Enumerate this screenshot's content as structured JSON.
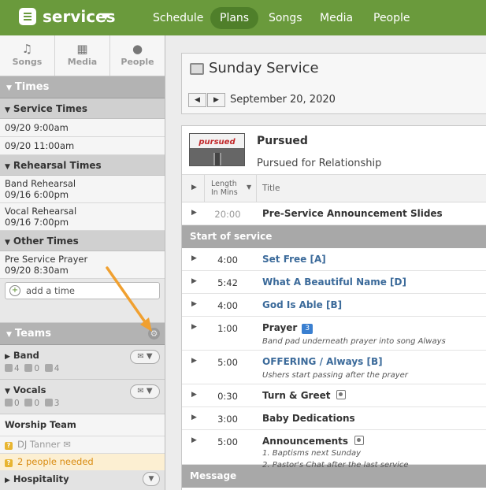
{
  "app": {
    "name": "services"
  },
  "nav": {
    "items": [
      "Schedule",
      "Plans",
      "Songs",
      "Media",
      "People"
    ],
    "active": "Plans"
  },
  "sidebar": {
    "tabs": [
      {
        "label": "Songs",
        "icon": "music-note-icon"
      },
      {
        "label": "Media",
        "icon": "film-icon"
      },
      {
        "label": "People",
        "icon": "person-icon"
      }
    ],
    "times_header": "Times",
    "service_times_header": "Service Times",
    "service_times": [
      "09/20 9:00am",
      "09/20 11:00am"
    ],
    "rehearsal_times_header": "Rehearsal Times",
    "rehearsal_times": [
      {
        "name": "Band Rehearsal",
        "time": "09/16 6:00pm"
      },
      {
        "name": "Vocal Rehearsal",
        "time": "09/16 7:00pm"
      }
    ],
    "other_times_header": "Other Times",
    "other_times": [
      {
        "name": "Pre Service Prayer",
        "time": "09/20 8:30am"
      }
    ],
    "add_time_label": "add a time",
    "teams_header": "Teams",
    "teams": [
      {
        "name": "Band",
        "confirmed": "4",
        "declined": "0",
        "unconfirmed": "4"
      },
      {
        "name": "Vocals",
        "confirmed": "0",
        "declined": "0",
        "unconfirmed": "3"
      }
    ],
    "worship_team_label": "Worship Team",
    "person_name": "DJ Tanner",
    "needed_label": "2 people needed",
    "hospitality_label": "Hospitality"
  },
  "plan": {
    "title": "Sunday Service",
    "date": "September 20, 2020",
    "series_title": "Pursued",
    "series_subtitle": "Pursued for Relationship",
    "series_art_text": "pursued",
    "columns": {
      "length_line1": "Length",
      "length_line2": "In Mins",
      "title": "Title"
    },
    "pre_items": [
      {
        "length": "20:00",
        "title": "Pre-Service Announcement Slides"
      }
    ],
    "section_label": "Start of service",
    "items": [
      {
        "length": "4:00",
        "title": "Set Free [A]",
        "song": true
      },
      {
        "length": "5:42",
        "title": "What A Beautiful Name [D]",
        "song": true
      },
      {
        "length": "4:00",
        "title": "God Is Able [B]",
        "song": true
      },
      {
        "length": "1:00",
        "title": "Prayer",
        "badge": "3",
        "note": "Band pad underneath prayer into song Always"
      },
      {
        "length": "5:00",
        "title": "OFFERING / Always [B]",
        "song": true,
        "note": "Ushers start passing after the prayer"
      },
      {
        "length": "0:30",
        "title": "Turn & Greet",
        "icon": true
      },
      {
        "length": "3:00",
        "title": "Baby Dedications"
      },
      {
        "length": "5:00",
        "title": "Announcements",
        "icon": true,
        "notes": [
          "1. Baptisms next Sunday",
          "2. Pastor's Chat after the last service"
        ]
      }
    ],
    "next_section_label": "Message"
  },
  "colors": {
    "brand_green": "#6a9a3c",
    "nav_active": "#4f7f2a",
    "song_blue": "#3b6a9a",
    "annotation_orange": "#f0a030"
  }
}
